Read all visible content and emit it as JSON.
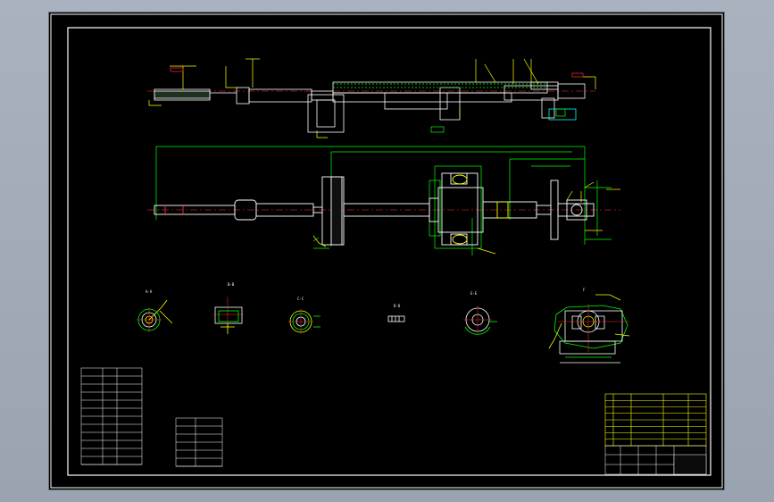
{
  "colors": {
    "background_outer": "#a2abb8",
    "canvas": "#000000",
    "frame": "#ffffff",
    "part_lines": "#ffffff",
    "dimension_lines": "#00ff00",
    "annotation": "#ffff00",
    "leader_red": "#ff2020",
    "cyan": "#00ffff"
  },
  "icons": [
    "engineering-drawing-sheet"
  ],
  "section_labels": {
    "a": "A-A",
    "b": "B-B",
    "c": "C-C",
    "d": "D-D",
    "e": "E-E",
    "f": "F"
  },
  "table1": {
    "title": "",
    "rows": [
      {
        "c1": "",
        "c2": "",
        "c3": ""
      },
      {
        "c1": "",
        "c2": "",
        "c3": ""
      },
      {
        "c1": "",
        "c2": "",
        "c3": ""
      },
      {
        "c1": "",
        "c2": "",
        "c3": ""
      },
      {
        "c1": "",
        "c2": "",
        "c3": ""
      },
      {
        "c1": "",
        "c2": "",
        "c3": ""
      },
      {
        "c1": "",
        "c2": "",
        "c3": ""
      },
      {
        "c1": "",
        "c2": "",
        "c3": ""
      },
      {
        "c1": "",
        "c2": "",
        "c3": ""
      },
      {
        "c1": "",
        "c2": "",
        "c3": ""
      },
      {
        "c1": "",
        "c2": "",
        "c3": ""
      },
      {
        "c1": "",
        "c2": "",
        "c3": ""
      }
    ]
  },
  "table2": {
    "title": "",
    "rows": [
      {
        "c1": "",
        "c2": ""
      },
      {
        "c1": "",
        "c2": ""
      },
      {
        "c1": "",
        "c2": ""
      },
      {
        "c1": "",
        "c2": ""
      },
      {
        "c1": "",
        "c2": ""
      },
      {
        "c1": "",
        "c2": ""
      }
    ]
  },
  "title_block": {
    "drawing_title": "",
    "scale": ""
  }
}
